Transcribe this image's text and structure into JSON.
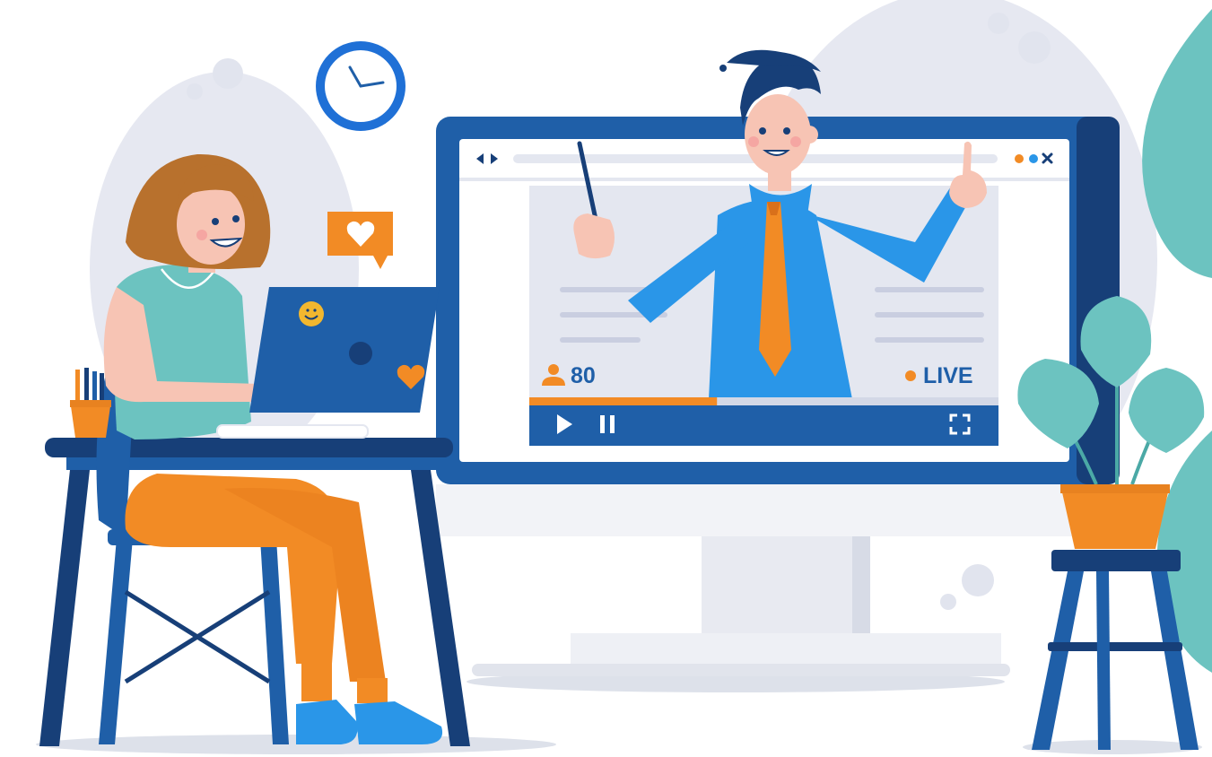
{
  "video_player": {
    "viewer_count": "80",
    "live_label": "LIVE",
    "controls": {
      "play": "play-icon",
      "pause": "pause-icon",
      "fullscreen": "fullscreen-icon",
      "back": "back-arrow-icon",
      "forward": "forward-arrow-icon",
      "window_dots": [
        "orange-dot",
        "blue-dot"
      ],
      "close": "close-icon"
    },
    "progress_fraction": 0.4
  },
  "icons": {
    "heart_bubble": "heart-bubble-icon",
    "clock": "clock-icon",
    "viewer": "person-icon",
    "live_dot": "live-dot-icon",
    "laptop_smiley": "smiley-sticker-icon",
    "laptop_heart": "heart-sticker-icon"
  },
  "colors": {
    "primary_blue": "#1f5fa8",
    "dark_blue": "#173f78",
    "accent_orange": "#f28b25",
    "teal": "#6cc3c0",
    "light_gray": "#e4e7f0",
    "bright_blue": "#2a96e8"
  }
}
